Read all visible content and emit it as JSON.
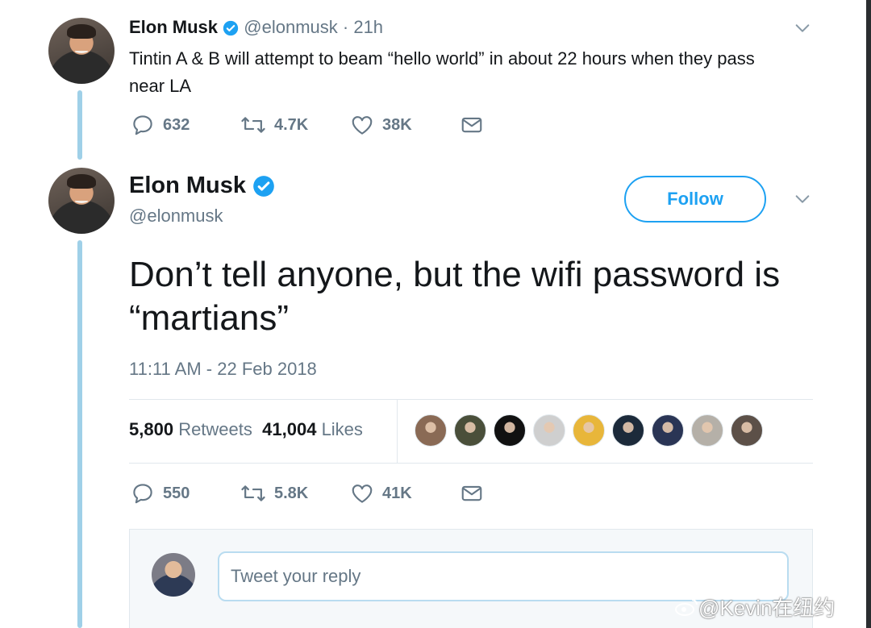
{
  "tweet1": {
    "name": "Elon Musk",
    "handle": "@elonmusk",
    "time": "· 21h",
    "text": "Tintin A & B will attempt to beam “hello world” in about 22 hours when they pass near LA",
    "replies": "632",
    "retweets": "4.7K",
    "likes": "38K"
  },
  "tweet2": {
    "name": "Elon Musk",
    "handle": "@elonmusk",
    "follow_label": "Follow",
    "text": "Don’t tell anyone, but the wifi password is “martians”",
    "timestamp": "11:11 AM - 22 Feb 2018",
    "retweet_count": "5,800",
    "retweet_label": "Retweets",
    "like_count": "41,004",
    "like_label": "Likes",
    "replies": "550",
    "retweets": "5.8K",
    "likes": "41K"
  },
  "reply": {
    "placeholder": "Tweet your reply"
  },
  "watermark": "@Kevin在纽约",
  "colors": {
    "accent": "#1da1f2",
    "muted": "#657786",
    "thread_line": "#9fd0e8"
  },
  "likers": [
    "#8a6a55",
    "#4a4f3a",
    "#111111",
    "#cfcfcf",
    "#e8b63a",
    "#1c2a3a",
    "#2a3555",
    "#b5b0a8",
    "#5c5048"
  ]
}
